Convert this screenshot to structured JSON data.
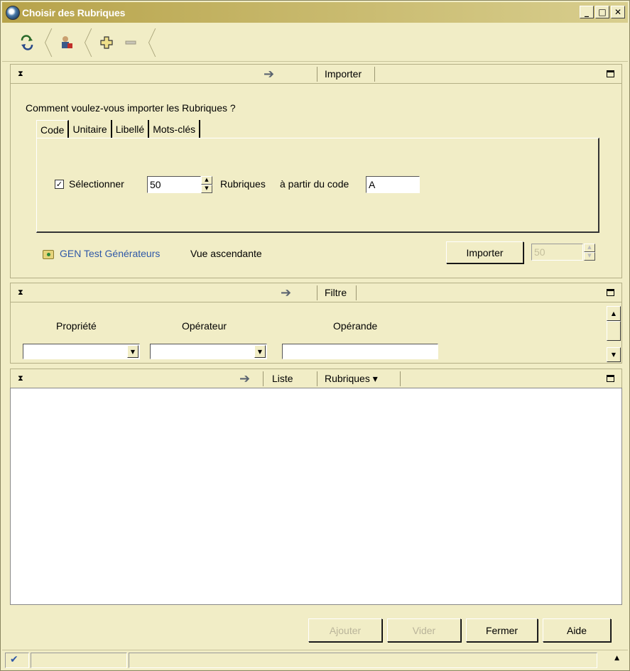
{
  "window": {
    "title": "Choisir des Rubriques",
    "controls": [
      "_",
      "□",
      "✕"
    ]
  },
  "toolbar": {
    "icons": [
      "refresh-icon",
      "user-icon",
      "add-icon",
      "remove-icon"
    ]
  },
  "import_section": {
    "header_label": "Importer",
    "prompt": "Comment voulez-vous importer les Rubriques ?",
    "tabs": [
      "Code",
      "Unitaire",
      "Libellé",
      "Mots-clés"
    ],
    "active_tab": "Code",
    "select_checked": true,
    "select_label": "Sélectionner",
    "count_value": "50",
    "rubriques_label": "Rubriques",
    "from_code_label": "à partir du code",
    "code_value": "A",
    "source_link": "GEN Test Générateurs",
    "view_label": "Vue ascendante",
    "import_button": "Importer",
    "import_count_value": "50"
  },
  "filter_section": {
    "header_label": "Filtre",
    "columns": [
      "Propriété",
      "Opérateur",
      "Opérande"
    ],
    "property_value": "",
    "operator_value": "",
    "operand_value": ""
  },
  "list_section": {
    "header_label": "Liste",
    "dropdown_label": "Rubriques ▾"
  },
  "footer": {
    "add_button": "Ajouter",
    "clear_button": "Vider",
    "close_button": "Fermer",
    "help_button": "Aide"
  },
  "colors": {
    "background": "#f1edc6",
    "title_gradient_start": "#b7a34a",
    "link": "#2f58a7"
  }
}
